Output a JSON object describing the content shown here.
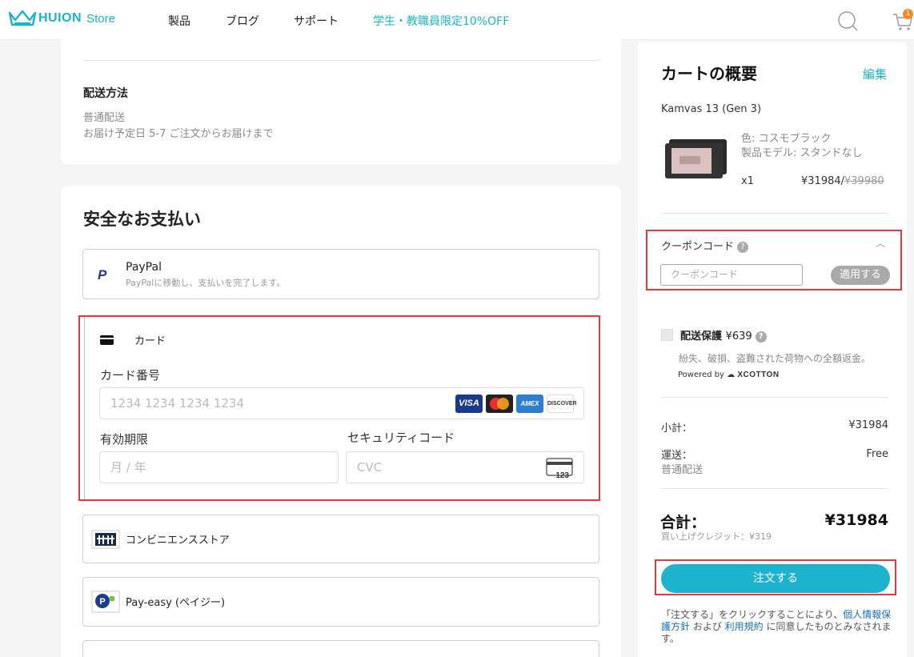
{
  "header": {
    "logo_text": "HUION",
    "logo_store": "Store",
    "nav": [
      "製品",
      "ブログ",
      "サポート"
    ],
    "promo": "学生・教職員限定10%OFF",
    "cart_count": "1",
    "accent_color": "#1db3c6"
  },
  "shipping": {
    "title": "配送方法",
    "method": "普通配送",
    "estimate": "お届け予定日 5-7 ご注文からお届けまで"
  },
  "payment": {
    "title": "安全なお支払い",
    "paypal": {
      "icon": "paypal-icon",
      "name": "PayPal",
      "desc": "PayPalに移動し、支払いを完了します。"
    },
    "card": {
      "icon": "credit-card-icon",
      "label": "カード",
      "number_label": "カード番号",
      "number_placeholder": "1234 1234 1234 1234",
      "brands": [
        "VISA",
        "MC",
        "AMEX",
        "DISCOVER"
      ],
      "expiry_label": "有効期限",
      "expiry_placeholder": "月 / 年",
      "cvc_label": "セキュリティコード",
      "cvc_placeholder": "CVC",
      "cvc_icon_text": "123"
    },
    "convenience": {
      "icon": "convenience-store-icon",
      "label": "コンビニエンスストア"
    },
    "payeasy": {
      "icon": "payeasy-icon",
      "label": "Pay-easy (ペイジー)"
    }
  },
  "summary": {
    "title": "カートの概要",
    "edit": "編集",
    "product": {
      "name": "Kamvas 13 (Gen 3)",
      "color": "色: コスモブラック",
      "model": "製品モデル: スタンドなし",
      "qty": "x1",
      "price": "¥31984/",
      "original_price": "¥39980"
    },
    "coupon": {
      "label": "クーポンコード",
      "placeholder": "クーポンコード",
      "apply": "適用する"
    },
    "insurance": {
      "title": "配送保護",
      "price": "¥639",
      "desc": "紛失、破損、盗難された荷物への全額返金。",
      "powered": "Powered by",
      "brand": "XCOTTON"
    },
    "subtotal_label": "小計：",
    "subtotal_value": "¥31984",
    "shipping_label": "運送：",
    "shipping_value": "Free",
    "shipping_method": "普通配送",
    "total_label": "合計：",
    "total_value": "¥31984",
    "credit": "買い上げクレジット：¥319",
    "order_button": "注文する",
    "terms": {
      "pre": "「注文する」をクリックすることにより、",
      "privacy": "個人情報保護方針",
      "mid": " および ",
      "tos": "利用規約",
      "post": " に同意したものとみなされます。"
    }
  }
}
